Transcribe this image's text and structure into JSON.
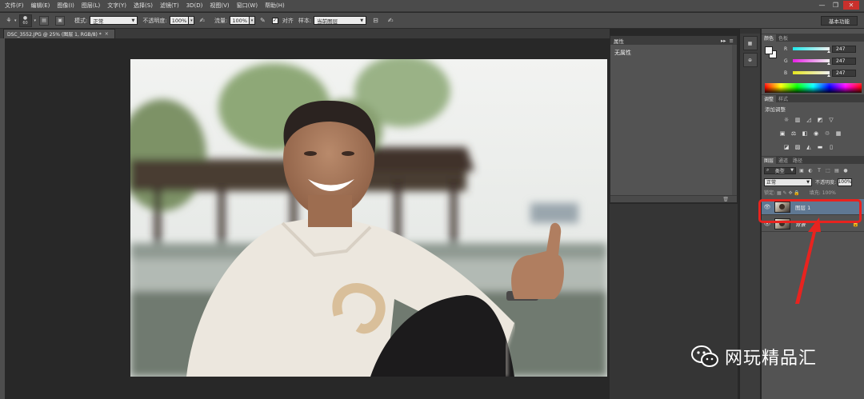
{
  "menu": [
    "文件(F)",
    "编辑(E)",
    "图像(I)",
    "图层(L)",
    "文字(Y)",
    "选择(S)",
    "滤镜(T)",
    "3D(D)",
    "视图(V)",
    "窗口(W)",
    "帮助(H)"
  ],
  "window_controls": {
    "minimize": "—",
    "restore": "❐",
    "close": "✕"
  },
  "options": {
    "brush_size": "60",
    "mode_label": "模式:",
    "mode_value": "正常",
    "opacity_label": "不透明度:",
    "opacity_value": "100%",
    "flow_label": "流量:",
    "flow_value": "100%",
    "align_label": "对齐",
    "sample_label": "样本:",
    "sample_value": "当前图层",
    "workspace": "基本功能"
  },
  "document": {
    "tab_title": "DSC_3552.JPG @ 25% (图层 1, RGB/8) *",
    "tab_close": "×"
  },
  "properties": {
    "title": "属性",
    "content": "无属性",
    "collapse": "▸▸",
    "menu": "≡"
  },
  "color": {
    "tabs": [
      "颜色",
      "色板"
    ],
    "channels": [
      {
        "label": "R",
        "value": "247",
        "gradient": "#19e6e6"
      },
      {
        "label": "G",
        "value": "247",
        "gradient": "#e619e6"
      },
      {
        "label": "B",
        "value": "247",
        "gradient": "#e6e619"
      }
    ],
    "foreground": "#f7f7f7",
    "background": "#f7f7f7"
  },
  "adjustments": {
    "tabs": [
      "调整",
      "样式"
    ],
    "title": "添加调整"
  },
  "layers": {
    "tabs": [
      "图层",
      "通道",
      "路径"
    ],
    "filter_value": "类型",
    "blend_mode": "正常",
    "opacity_label": "不透明度:",
    "opacity_value": "100%",
    "lock_label": "锁定:",
    "fill_label": "填充:",
    "fill_value": "100%",
    "items": [
      {
        "name": "图层 1",
        "visible": true,
        "selected": true
      },
      {
        "name": "背景",
        "visible": true,
        "locked": true
      }
    ]
  },
  "watermark": {
    "text": "网玩精品汇"
  },
  "annotation": {
    "color": "#e8231f"
  }
}
